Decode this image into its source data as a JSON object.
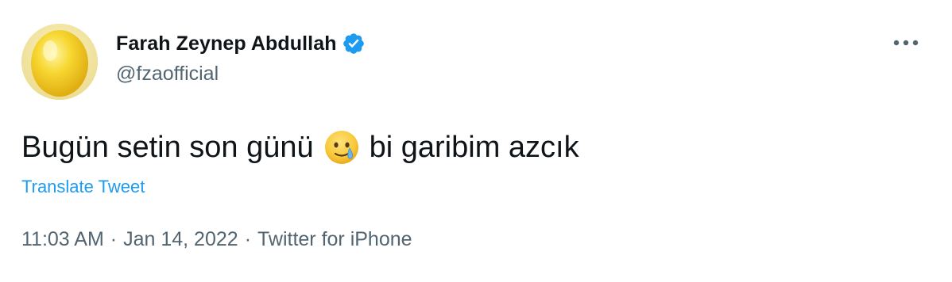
{
  "author": {
    "display_name": "Farah Zeynep Abdullah",
    "handle": "@fzaofficial",
    "verified": true
  },
  "icons": {
    "verified": "verified-badge-icon",
    "more": "more-options-icon",
    "emoji": "face-holding-back-tears-emoji"
  },
  "tweet": {
    "text_before_emoji": "Bugün setin son günü",
    "text_after_emoji": "bi garibim azcık",
    "translate_label": "Translate Tweet"
  },
  "meta": {
    "time": "11:03 AM",
    "separator": "·",
    "date": "Jan 14, 2022",
    "source": "Twitter for iPhone"
  },
  "colors": {
    "link": "#1d9bf0",
    "secondary_text": "#536471",
    "primary_text": "#0f1419",
    "verified": "#1d9bf0"
  }
}
